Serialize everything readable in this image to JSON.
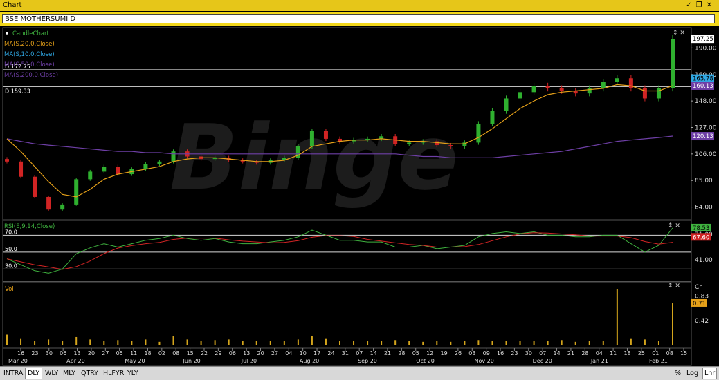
{
  "window": {
    "title": "Chart",
    "controls": [
      "pin-icon",
      "restore-icon",
      "close-icon"
    ]
  },
  "symbol": "BSE MOTHERSUMI D",
  "watermark": "Binge",
  "price_panel": {
    "legend": [
      {
        "label": "CandleChart",
        "color": "#3fb23f"
      },
      {
        "label": "MA(S,20.0,Close)",
        "color": "#e6a119"
      },
      {
        "label": "MA(S,10.0,Close)",
        "color": "#2fa7e3"
      },
      {
        "label": "MA(S,50.0,Close)",
        "color": "#6e3fa6"
      },
      {
        "label": "MA(S,200.0,Close)",
        "color": "#6e3fa6"
      }
    ],
    "hline_labels": [
      "D:172.75",
      "D:159.33"
    ],
    "hlines": [
      172.75,
      159.33
    ],
    "axis_ticks": [
      "190.00",
      "169.00",
      "148.00",
      "127.00",
      "106.00",
      "85.00",
      "64.00"
    ],
    "axis_values": [
      190,
      169,
      148,
      127,
      106,
      85,
      64
    ],
    "value_tags": [
      {
        "text": "197.25",
        "bg": "#ffffff",
        "fg": "#000000",
        "value": 197.25
      },
      {
        "text": "165.78",
        "bg": "#2fa7e3",
        "fg": "#000000",
        "value": 165.78
      },
      {
        "text": "160.13",
        "bg": "#6e3fa6",
        "fg": "#ffffff",
        "value": 160.13
      },
      {
        "text": "120.13",
        "bg": "#6e3fa6",
        "fg": "#ffffff",
        "value": 120.13
      }
    ]
  },
  "rsi_panel": {
    "legend": "RSI(E,9,14,Close)",
    "levels": [
      {
        "label": "70.0",
        "value": 70
      },
      {
        "label": "50.0",
        "value": 50
      },
      {
        "label": "30.0",
        "value": 30
      }
    ],
    "axis_ticks": [
      "71.00",
      "41.00"
    ],
    "axis_values": [
      71,
      41
    ],
    "value_tags": [
      {
        "text": "78.53",
        "bg": "#3fb23f",
        "fg": "#000000",
        "value": 78.53
      },
      {
        "text": "67.60",
        "bg": "#d12424",
        "fg": "#ffffff",
        "value": 67.6
      }
    ]
  },
  "vol_panel": {
    "legend": "Vol",
    "unit": "Cr",
    "axis_ticks": [
      "0.83",
      "0.42"
    ],
    "axis_values": [
      0.83,
      0.42
    ],
    "value_tags": [
      {
        "text": "0.71",
        "bg": "#e6a119",
        "fg": "#000000",
        "value": 0.71
      }
    ]
  },
  "x_axis": {
    "day_labels": [
      "16",
      "23",
      "30",
      "06",
      "13",
      "20",
      "27",
      "05",
      "11",
      "18",
      "02",
      "08",
      "15",
      "22",
      "29",
      "06",
      "13",
      "20",
      "27",
      "04",
      "10",
      "17",
      "24",
      "31",
      "07",
      "14",
      "21",
      "28",
      "05",
      "12",
      "19",
      "26",
      "03",
      "09",
      "16",
      "23",
      "30",
      "07",
      "14",
      "21",
      "28",
      "04",
      "11",
      "18",
      "25",
      "01",
      "08",
      "15"
    ],
    "month_labels": [
      "Mar 20",
      "Apr 20",
      "May 20",
      "Jun 20",
      "Jul 20",
      "Aug 20",
      "Sep 20",
      "Oct 20",
      "Nov 20",
      "Dec 20",
      "Jan 21",
      "Feb 21"
    ]
  },
  "bottom_bar": {
    "timeframes": [
      "INTRA",
      "DLY",
      "WLY",
      "MLY",
      "QTRY",
      "HLFYR",
      "YLY"
    ],
    "active": "DLY",
    "right_buttons": [
      "%",
      "Log",
      "Lnr"
    ]
  },
  "chart_data": {
    "type": "line",
    "title": "BSE MOTHERSUMI D",
    "x": [
      "2020-03-13",
      "2020-03-20",
      "2020-03-27",
      "2020-04-03",
      "2020-04-10",
      "2020-04-17",
      "2020-04-24",
      "2020-05-01",
      "2020-05-08",
      "2020-05-15",
      "2020-05-22",
      "2020-05-29",
      "2020-06-05",
      "2020-06-12",
      "2020-06-19",
      "2020-06-26",
      "2020-07-03",
      "2020-07-10",
      "2020-07-17",
      "2020-07-24",
      "2020-07-31",
      "2020-08-07",
      "2020-08-14",
      "2020-08-21",
      "2020-08-28",
      "2020-09-04",
      "2020-09-11",
      "2020-09-18",
      "2020-09-25",
      "2020-10-02",
      "2020-10-09",
      "2020-10-16",
      "2020-10-23",
      "2020-10-30",
      "2020-11-06",
      "2020-11-13",
      "2020-11-20",
      "2020-11-27",
      "2020-12-04",
      "2020-12-11",
      "2020-12-18",
      "2020-12-25",
      "2021-01-01",
      "2021-01-08",
      "2021-01-15",
      "2021-01-22",
      "2021-01-29",
      "2021-02-05",
      "2021-02-12"
    ],
    "series": [
      {
        "name": "Close",
        "values": [
          100,
          88,
          72,
          62,
          66,
          86,
          92,
          96,
          90,
          94,
          98,
          100,
          108,
          104,
          102,
          103,
          101,
          100,
          99,
          101,
          103,
          112,
          124,
          118,
          116,
          117,
          118,
          120,
          114,
          115,
          116,
          113,
          112,
          115,
          130,
          140,
          150,
          155,
          160,
          158,
          156,
          154,
          158,
          163,
          166,
          158,
          150,
          158,
          197.25
        ]
      },
      {
        "name": "MA(S,20.0,Close)",
        "values": [
          118,
          108,
          96,
          84,
          74,
          72,
          78,
          86,
          90,
          92,
          94,
          96,
          100,
          102,
          103,
          103,
          102,
          101,
          100,
          100,
          101,
          105,
          112,
          114,
          116,
          117,
          117,
          118,
          117,
          116,
          116,
          115,
          114,
          114,
          119,
          126,
          134,
          142,
          148,
          153,
          155,
          156,
          157,
          158,
          161,
          160,
          156,
          156,
          160.13
        ]
      },
      {
        "name": "MA(S,200.0,Close)",
        "values": [
          118,
          116,
          114,
          113,
          112,
          111,
          110,
          109,
          108,
          108,
          107,
          107,
          106,
          106,
          106,
          106,
          106,
          106,
          106,
          106,
          106,
          106,
          106,
          106,
          106,
          106,
          106,
          106,
          106,
          105,
          104,
          104,
          103,
          103,
          103,
          103,
          104,
          105,
          106,
          107,
          108,
          110,
          112,
          114,
          116,
          117,
          118,
          119,
          120.13
        ]
      },
      {
        "name": "RSI(E,9,14,Close)",
        "values": [
          42,
          35,
          28,
          25,
          30,
          48,
          55,
          60,
          56,
          60,
          64,
          66,
          70,
          66,
          64,
          66,
          62,
          60,
          60,
          62,
          64,
          68,
          76,
          70,
          64,
          64,
          62,
          62,
          56,
          56,
          58,
          54,
          56,
          58,
          68,
          72,
          74,
          72,
          74,
          70,
          70,
          68,
          68,
          70,
          70,
          60,
          50,
          58,
          78.53
        ]
      },
      {
        "name": "Vol",
        "values": [
          0.18,
          0.12,
          0.08,
          0.1,
          0.07,
          0.14,
          0.1,
          0.08,
          0.09,
          0.07,
          0.1,
          0.06,
          0.16,
          0.1,
          0.08,
          0.09,
          0.1,
          0.08,
          0.07,
          0.08,
          0.07,
          0.1,
          0.16,
          0.12,
          0.08,
          0.08,
          0.07,
          0.08,
          0.09,
          0.07,
          0.06,
          0.07,
          0.06,
          0.07,
          0.09,
          0.08,
          0.08,
          0.07,
          0.08,
          0.07,
          0.09,
          0.06,
          0.07,
          0.08,
          0.95,
          0.12,
          0.1,
          0.08,
          0.71
        ]
      }
    ],
    "ylim": [
      55,
      205
    ],
    "grid": false,
    "legend": "top-left"
  }
}
